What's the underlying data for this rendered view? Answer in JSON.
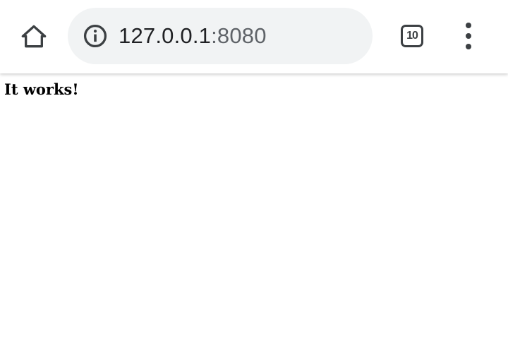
{
  "browser": {
    "home_icon": "home-icon",
    "omnibox": {
      "security_icon": "info-icon",
      "url_host": "127.0.0.1",
      "url_port": ":8080"
    },
    "tab_count": "10",
    "menu_icon": "more-vert-icon"
  },
  "page": {
    "heading": "It works!"
  },
  "colors": {
    "toolbar_bg": "#ffffff",
    "omnibox_bg": "#f1f3f4",
    "icon": "#3c4043",
    "url_host": "#202124",
    "url_port": "#5f6368"
  }
}
